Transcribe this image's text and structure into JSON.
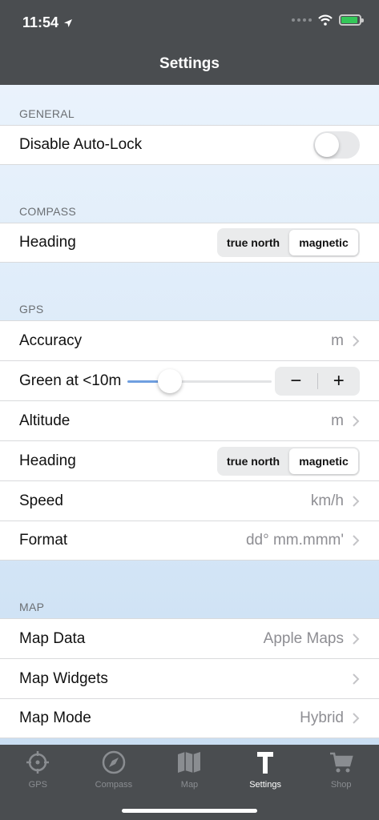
{
  "status": {
    "time": "11:54"
  },
  "nav": {
    "title": "Settings"
  },
  "general": {
    "header": "GENERAL",
    "disable_autolock_label": "Disable Auto-Lock"
  },
  "compass": {
    "header": "COMPASS",
    "heading_label": "Heading",
    "heading_options": [
      "true north",
      "magnetic"
    ],
    "heading_selected": "magnetic"
  },
  "gps": {
    "header": "GPS",
    "accuracy_label": "Accuracy",
    "accuracy_value": "m",
    "green_label": "Green at <10m",
    "green_slider_fraction": 0.25,
    "stepper_minus": "−",
    "stepper_plus": "+",
    "altitude_label": "Altitude",
    "altitude_value": "m",
    "heading_label": "Heading",
    "heading_options": [
      "true north",
      "magnetic"
    ],
    "heading_selected": "magnetic",
    "speed_label": "Speed",
    "speed_value": "km/h",
    "format_label": "Format",
    "format_value": "dd° mm.mmm'"
  },
  "map": {
    "header": "MAP",
    "data_label": "Map Data",
    "data_value": "Apple Maps",
    "widgets_label": "Map Widgets",
    "mode_label": "Map Mode",
    "mode_value": "Hybrid"
  },
  "tabs": [
    {
      "label": "GPS",
      "icon": "crosshair-icon"
    },
    {
      "label": "Compass",
      "icon": "compass-icon"
    },
    {
      "label": "Map",
      "icon": "map-icon"
    },
    {
      "label": "Settings",
      "icon": "hammer-icon"
    },
    {
      "label": "Shop",
      "icon": "cart-icon"
    }
  ],
  "active_tab": "Settings",
  "colors": {
    "bar_bg": "#4a4d50",
    "accent": "#6f9fe0",
    "battery": "#34c759"
  }
}
